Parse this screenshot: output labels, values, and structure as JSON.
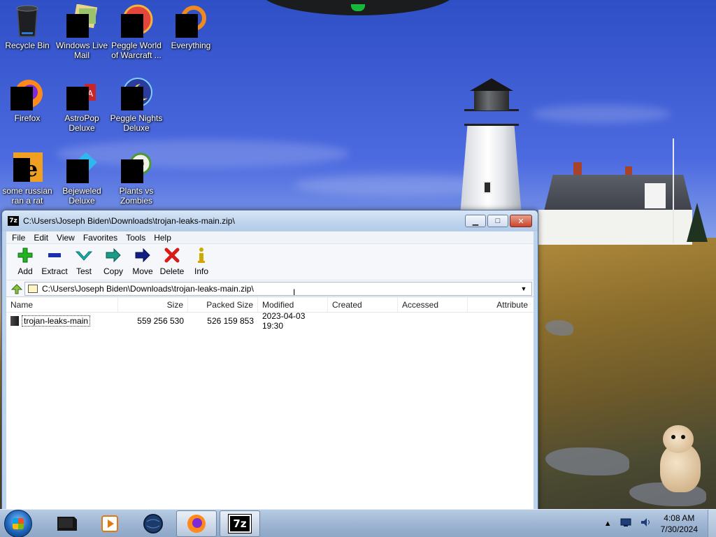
{
  "desktop": {
    "icons": [
      {
        "label": "Recycle Bin"
      },
      {
        "label": "Windows Live Mail"
      },
      {
        "label": "Peggle World of Warcraft ..."
      },
      {
        "label": "Everything"
      },
      {
        "label": "Firefox"
      },
      {
        "label": "AstroPop Deluxe"
      },
      {
        "label": "Peggle Nights Deluxe"
      },
      {
        "label": "some russian ran a rat"
      },
      {
        "label": "Bejeweled Deluxe"
      },
      {
        "label": "Plants vs Zombies"
      }
    ]
  },
  "window": {
    "app_badge": "7z",
    "title": "C:\\Users\\Joseph Biden\\Downloads\\trojan-leaks-main.zip\\",
    "controls": {
      "minimize": "▁",
      "maximize": "□",
      "close": "✕"
    },
    "menu": [
      "File",
      "Edit",
      "View",
      "Favorites",
      "Tools",
      "Help"
    ],
    "toolbar": [
      {
        "label": "Add",
        "icon": "plus-icon",
        "color": "#1aa01a"
      },
      {
        "label": "Extract",
        "icon": "minus-icon",
        "color": "#1b2fae"
      },
      {
        "label": "Test",
        "icon": "check-icon",
        "color": "#15a4a0"
      },
      {
        "label": "Copy",
        "icon": "copy-arrow-icon",
        "color": "#1a8c7a"
      },
      {
        "label": "Move",
        "icon": "move-arrow-icon",
        "color": "#101a7a"
      },
      {
        "label": "Delete",
        "icon": "delete-x-icon",
        "color": "#d11a1a"
      },
      {
        "label": "Info",
        "icon": "info-icon",
        "color": "#c2a000"
      }
    ],
    "address": "C:\\Users\\Joseph Biden\\Downloads\\trojan-leaks-main.zip\\",
    "columns": [
      "Name",
      "Size",
      "Packed Size",
      "Modified",
      "Created",
      "Accessed",
      "Attribute"
    ],
    "rows": [
      {
        "name": "trojan-leaks-main",
        "size": "559 256 530",
        "packed": "526 159 853",
        "modified": "2023-04-03 19:30",
        "created": "",
        "accessed": "",
        "attribute": ""
      }
    ]
  },
  "taskbar": {
    "apps": [
      {
        "name": "taskbar-app-monitor"
      },
      {
        "name": "taskbar-app-media-player"
      },
      {
        "name": "taskbar-app-globe"
      },
      {
        "name": "taskbar-app-firefox",
        "active": true
      },
      {
        "name": "taskbar-app-7zip",
        "label": "7z",
        "active": true
      }
    ],
    "clock": {
      "time": "4:08 AM",
      "date": "7/30/2024"
    }
  }
}
